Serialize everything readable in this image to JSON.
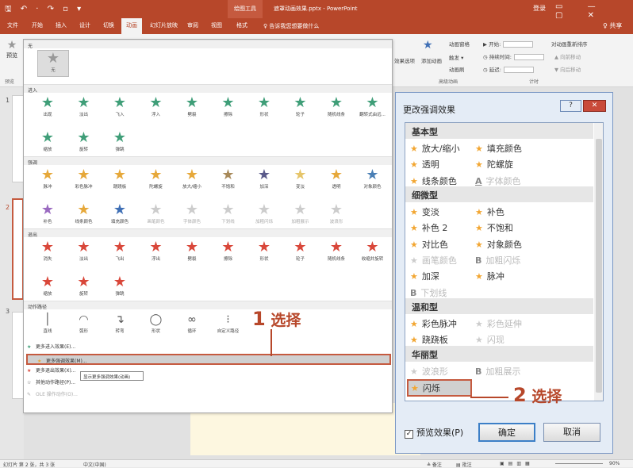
{
  "window": {
    "quick_access": "🖫 ↶ · ↷ ▫ ▾",
    "context_tab": "绘图工具",
    "title": "遮罩动画效果.pptx - PowerPoint",
    "login": "登录",
    "window_controls": "▭ — ▢ ✕"
  },
  "tabs": [
    {
      "label": "文件"
    },
    {
      "label": "开始"
    },
    {
      "label": "插入"
    },
    {
      "label": "设计"
    },
    {
      "label": "切换"
    },
    {
      "label": "动画"
    },
    {
      "label": "幻灯片放映"
    },
    {
      "label": "审阅"
    },
    {
      "label": "视图"
    },
    {
      "label": "格式"
    }
  ],
  "tell_me": "♀ 告诉我您想要做什么",
  "share": "♀ 共享",
  "ribbon": {
    "preview_label": "预览",
    "preview_group": "预览",
    "effect_options": "效果选项",
    "add_animation": "添加动画",
    "animation_pane": "动画窗格",
    "trigger": "触发 ▾",
    "animation_painter": "动画刷",
    "advanced_group": "高级动画",
    "start_label": "▶ 开始:",
    "duration_label": "◷ 持续时间:",
    "delay_label": "◷ 延迟:",
    "reorder_label": "对动画重新排序",
    "move_earlier": "▲ 向前移动",
    "move_later": "▼ 向后移动",
    "timing_group": "计时"
  },
  "left_pane": {
    "slides": [
      "1",
      "2",
      "3"
    ]
  },
  "gallery": {
    "none_section": "无",
    "none_item": "无",
    "entrance_section": "进入",
    "entrance": [
      {
        "label": "出现",
        "color": "#3f9e78",
        "disabled": false
      },
      {
        "label": "淡出",
        "color": "#3f9e78",
        "disabled": false
      },
      {
        "label": "飞入",
        "color": "#3f9e78",
        "disabled": false
      },
      {
        "label": "浮入",
        "color": "#3f9e78",
        "disabled": false
      },
      {
        "label": "劈裂",
        "color": "#3f9e78",
        "disabled": false
      },
      {
        "label": "擦除",
        "color": "#3f9e78",
        "disabled": false
      },
      {
        "label": "形状",
        "color": "#3f9e78",
        "disabled": false
      },
      {
        "label": "轮子",
        "color": "#3f9e78",
        "disabled": false
      },
      {
        "label": "随机线条",
        "color": "#3f9e78",
        "disabled": false
      },
      {
        "label": "翻转式由远...",
        "color": "#3f9e78",
        "disabled": false
      },
      {
        "label": "缩放",
        "color": "#3f9e78",
        "disabled": false
      },
      {
        "label": "旋转",
        "color": "#3f9e78",
        "disabled": false
      },
      {
        "label": "弹跳",
        "color": "#3f9e78",
        "disabled": false
      }
    ],
    "emphasis_section": "强调",
    "emphasis": [
      {
        "label": "脉冲",
        "color": "#e6a83a",
        "disabled": false
      },
      {
        "label": "彩色脉冲",
        "color": "#e6a83a",
        "disabled": false
      },
      {
        "label": "跷跷板",
        "color": "#e6a83a",
        "disabled": false
      },
      {
        "label": "陀螺旋",
        "color": "#e6a83a",
        "disabled": false
      },
      {
        "label": "放大/缩小",
        "color": "#e6a83a",
        "disabled": false
      },
      {
        "label": "不饱和",
        "color": "#a88a5a",
        "disabled": false
      },
      {
        "label": "加深",
        "color": "#5a5a8a",
        "disabled": false
      },
      {
        "label": "变淡",
        "color": "#e6c56a",
        "disabled": false
      },
      {
        "label": "透明",
        "color": "#e6a83a",
        "disabled": false
      },
      {
        "label": "对象颜色",
        "color": "#4a7fb5",
        "disabled": false
      },
      {
        "label": "补色",
        "color": "#9a6ac0",
        "disabled": false
      },
      {
        "label": "线条颜色",
        "color": "#e6a83a",
        "disabled": false
      },
      {
        "label": "填充颜色",
        "color": "#3f6fb5",
        "disabled": false
      },
      {
        "label": "画笔颜色",
        "color": "#cccccc",
        "disabled": true
      },
      {
        "label": "字体颜色",
        "color": "#cccccc",
        "disabled": true
      },
      {
        "label": "下划线",
        "color": "#cccccc",
        "disabled": true
      },
      {
        "label": "加粗闪烁",
        "color": "#cccccc",
        "disabled": true
      },
      {
        "label": "加粗展示",
        "color": "#cccccc",
        "disabled": true
      },
      {
        "label": "波浪形",
        "color": "#cccccc",
        "disabled": true
      }
    ],
    "exit_section": "退出",
    "exit": [
      {
        "label": "消失",
        "color": "#d9473a",
        "disabled": false
      },
      {
        "label": "淡出",
        "color": "#d9473a",
        "disabled": false
      },
      {
        "label": "飞出",
        "color": "#d9473a",
        "disabled": false
      },
      {
        "label": "浮出",
        "color": "#d9473a",
        "disabled": false
      },
      {
        "label": "劈裂",
        "color": "#d9473a",
        "disabled": false
      },
      {
        "label": "擦除",
        "color": "#d9473a",
        "disabled": false
      },
      {
        "label": "形状",
        "color": "#d9473a",
        "disabled": false
      },
      {
        "label": "轮子",
        "color": "#d9473a",
        "disabled": false
      },
      {
        "label": "随机线条",
        "color": "#d9473a",
        "disabled": false
      },
      {
        "label": "收缩并旋转",
        "color": "#d9473a",
        "disabled": false
      },
      {
        "label": "缩放",
        "color": "#d9473a",
        "disabled": false
      },
      {
        "label": "旋转",
        "color": "#d9473a",
        "disabled": false
      },
      {
        "label": "弹跳",
        "color": "#d9473a",
        "disabled": false
      }
    ],
    "motion_section": "动作路径",
    "motion": [
      {
        "label": "直线",
        "glyph": "│"
      },
      {
        "label": "弧形",
        "glyph": "◠"
      },
      {
        "label": "转弯",
        "glyph": "↴"
      },
      {
        "label": "形状",
        "glyph": "◯"
      },
      {
        "label": "循环",
        "glyph": "∞"
      },
      {
        "label": "自定义路径",
        "glyph": "⁝"
      }
    ],
    "menu": [
      {
        "icon": "★",
        "color": "#3f9e78",
        "label": "更多进入效果(E)...",
        "highlight": false,
        "disabled": false
      },
      {
        "icon": "★",
        "color": "#e6a83a",
        "label": "更多强调效果(M)...",
        "highlight": true,
        "disabled": false
      },
      {
        "icon": "★",
        "color": "#d9473a",
        "label": "更多退出效果(X)...",
        "highlight": false,
        "disabled": false
      },
      {
        "icon": "☆",
        "color": "#555555",
        "label": "其他动作路径(P)...",
        "highlight": false,
        "disabled": false
      },
      {
        "icon": "✎",
        "color": "#aaaaaa",
        "label": "OLE 操作动作(O)...",
        "highlight": false,
        "disabled": true
      }
    ],
    "tooltip": "显示更多强调效果(动画)"
  },
  "callouts": {
    "one_num": "1",
    "one_text": "选择",
    "two_num": "2",
    "two_text": "选择"
  },
  "dialog": {
    "title": "更改强调效果",
    "help": "?",
    "close": "✕",
    "basic_header": "基本型",
    "basic": [
      {
        "label": "放大/缩小",
        "kind": "star",
        "disabled": false
      },
      {
        "label": "填充颜色",
        "kind": "star",
        "disabled": false
      },
      {
        "label": "透明",
        "kind": "star",
        "disabled": false
      },
      {
        "label": "陀螺旋",
        "kind": "star",
        "disabled": false
      },
      {
        "label": "线条颜色",
        "kind": "star",
        "disabled": false
      },
      {
        "label": "字体颜色",
        "kind": "A",
        "disabled": true
      }
    ],
    "subtle_header": "细微型",
    "subtle": [
      {
        "label": "变淡",
        "kind": "star",
        "disabled": false
      },
      {
        "label": "补色",
        "kind": "star",
        "disabled": false
      },
      {
        "label": "补色 2",
        "kind": "star",
        "disabled": false
      },
      {
        "label": "不饱和",
        "kind": "star",
        "disabled": false
      },
      {
        "label": "对比色",
        "kind": "star",
        "disabled": false
      },
      {
        "label": "对象颜色",
        "kind": "star",
        "disabled": false
      },
      {
        "label": "画笔颜色",
        "kind": "star",
        "disabled": true
      },
      {
        "label": "加粗闪烁",
        "kind": "B",
        "disabled": true
      },
      {
        "label": "加深",
        "kind": "star",
        "disabled": false
      },
      {
        "label": "脉冲",
        "kind": "star",
        "disabled": false
      },
      {
        "label": "下划线",
        "kind": "B",
        "disabled": true
      }
    ],
    "moderate_header": "温和型",
    "moderate": [
      {
        "label": "彩色脉冲",
        "kind": "star",
        "disabled": false
      },
      {
        "label": "彩色延伸",
        "kind": "star",
        "disabled": true
      },
      {
        "label": "跷跷板",
        "kind": "star",
        "disabled": false
      },
      {
        "label": "闪现",
        "kind": "star",
        "disabled": true
      }
    ],
    "exciting_header": "华丽型",
    "exciting": [
      {
        "label": "波浪形",
        "kind": "star",
        "disabled": true
      },
      {
        "label": "加粗展示",
        "kind": "B",
        "disabled": true
      },
      {
        "label": "闪烁",
        "kind": "star",
        "disabled": false,
        "selected": true
      }
    ],
    "preview_check": "✓",
    "preview_label": "预览效果(P)",
    "ok": "确定",
    "cancel": "取消"
  },
  "status": {
    "slide_info": "幻灯片 第 2 张，共 3 张",
    "language": "中文(中国)",
    "notes": "≜ 备注",
    "comments": "▤ 批注",
    "zoom": "90%"
  }
}
